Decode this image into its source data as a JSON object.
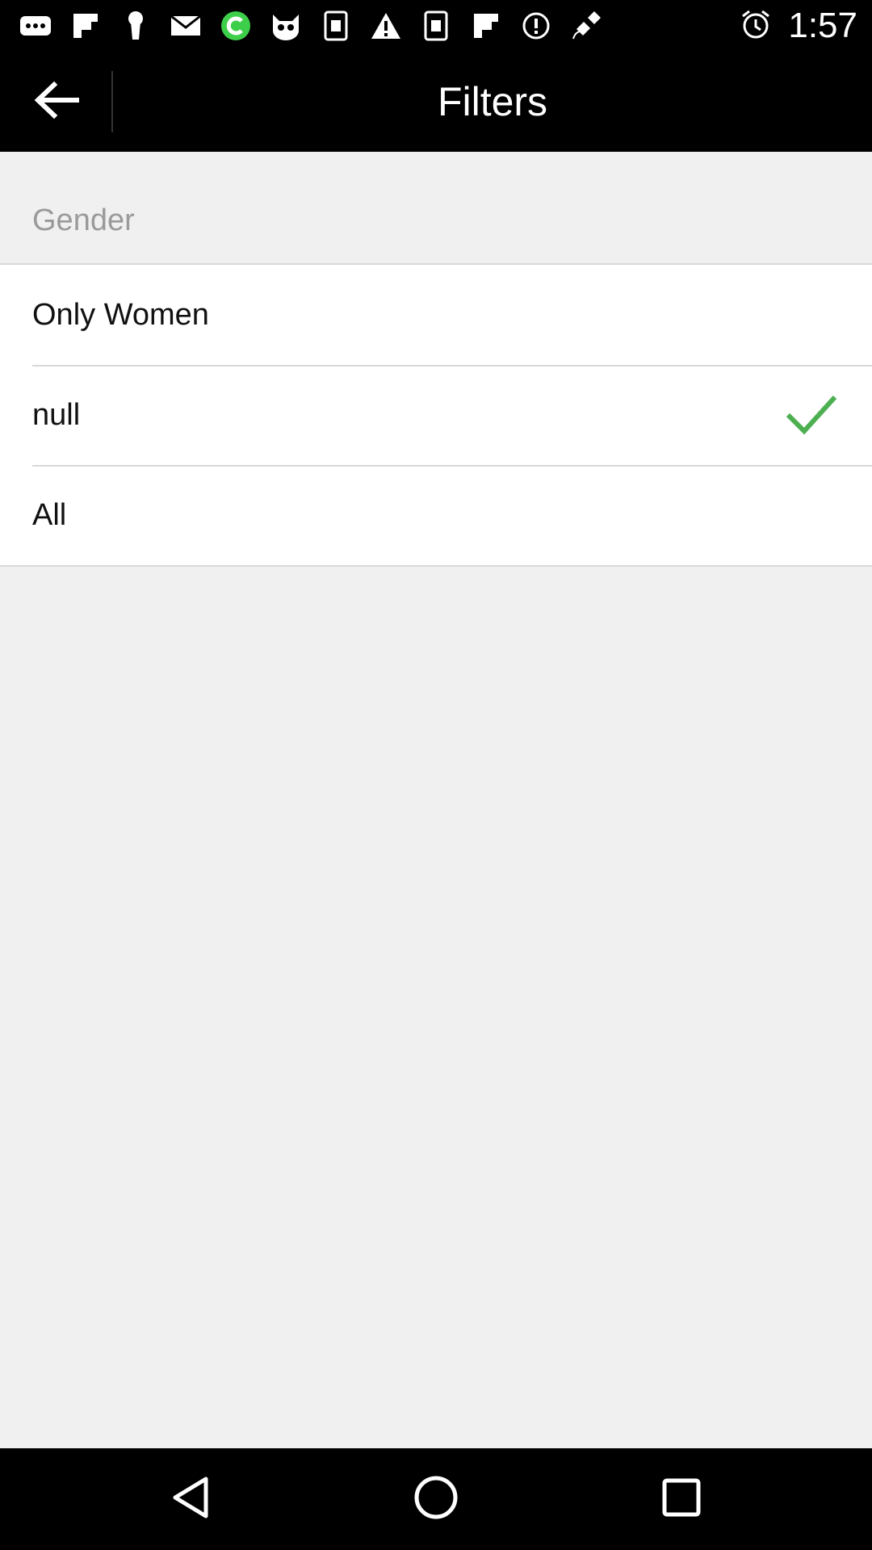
{
  "status_bar": {
    "time": "1:57",
    "icons": [
      "dots-icon",
      "flipboard-icon",
      "keyhole-icon",
      "mail-icon",
      "green-c-app-icon",
      "cat-mascot-icon",
      "frame-icon",
      "warning-icon",
      "frame-icon",
      "flipboard-icon",
      "info-icon",
      "fake-gps-satellite-icon",
      "alarm-icon"
    ]
  },
  "app_bar": {
    "title": "Filters",
    "back_icon": "arrow-left-icon"
  },
  "section": {
    "header": "Gender"
  },
  "options": [
    {
      "label": "Only Women",
      "selected": false
    },
    {
      "label": "null",
      "selected": true
    },
    {
      "label": "All",
      "selected": false
    }
  ],
  "colors": {
    "check": "#4caf50",
    "app_bar_bg": "#000000",
    "page_bg": "#f0f0f0"
  },
  "nav_bar": {
    "icons": [
      "back-triangle-icon",
      "home-circle-icon",
      "recents-square-icon"
    ]
  }
}
